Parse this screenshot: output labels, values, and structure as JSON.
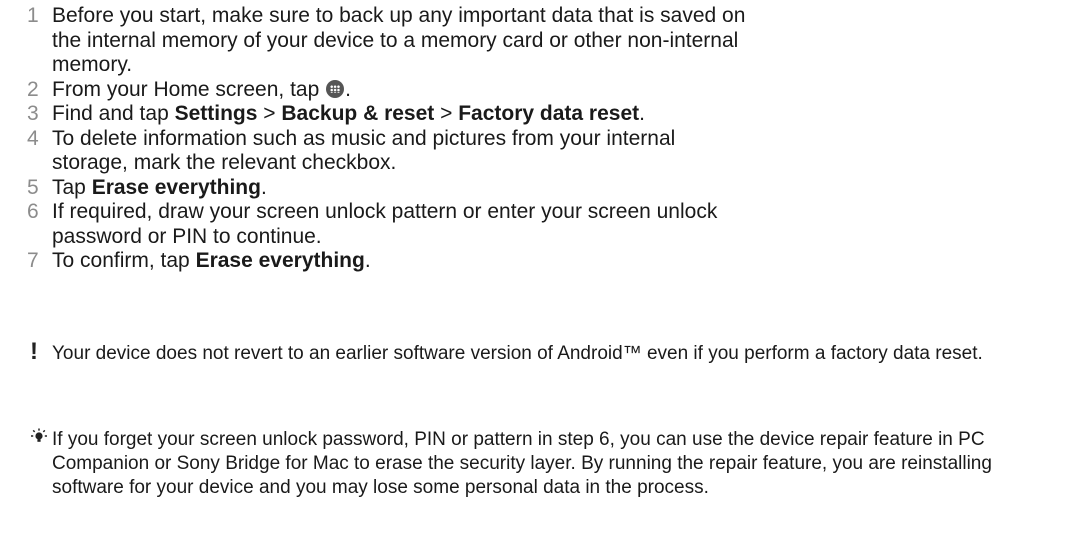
{
  "steps": [
    {
      "num": "1",
      "parts": [
        {
          "text": "Before you start, make sure to back up any important data that is saved on the internal memory of your device to a memory card or other non-internal memory.",
          "bold": false
        }
      ]
    },
    {
      "num": "2",
      "parts": [
        {
          "text": "From your Home screen, tap ",
          "bold": false
        },
        {
          "icon": "apps-icon"
        },
        {
          "text": ".",
          "bold": false
        }
      ]
    },
    {
      "num": "3",
      "parts": [
        {
          "text": "Find and tap ",
          "bold": false
        },
        {
          "text": "Settings",
          "bold": true
        },
        {
          "text": " > ",
          "bold": false
        },
        {
          "text": "Backup & reset",
          "bold": true
        },
        {
          "text": " > ",
          "bold": false
        },
        {
          "text": "Factory data reset",
          "bold": true
        },
        {
          "text": ".",
          "bold": false
        }
      ]
    },
    {
      "num": "4",
      "parts": [
        {
          "text": "To delete information such as music and pictures from your internal storage, mark the relevant checkbox.",
          "bold": false
        }
      ]
    },
    {
      "num": "5",
      "parts": [
        {
          "text": "Tap ",
          "bold": false
        },
        {
          "text": "Erase everything",
          "bold": true
        },
        {
          "text": ".",
          "bold": false
        }
      ]
    },
    {
      "num": "6",
      "parts": [
        {
          "text": "If required, draw your screen unlock pattern or enter your screen unlock password or PIN to continue.",
          "bold": false
        }
      ]
    },
    {
      "num": "7",
      "parts": [
        {
          "text": "To confirm, tap ",
          "bold": false
        },
        {
          "text": "Erase everything",
          "bold": true
        },
        {
          "text": ".",
          "bold": false
        }
      ]
    }
  ],
  "warning": {
    "icon": "exclamation-icon",
    "symbol": "!",
    "text": "Your device does not revert to an earlier software version of Android™ even if you perform a factory data reset."
  },
  "tip": {
    "icon": "lightbulb-icon",
    "text": "If you forget your screen unlock password, PIN or pattern in step 6, you can use the device repair feature in PC Companion or Sony Bridge for Mac to erase the security layer. By running the repair feature, you are reinstalling software for your device and you may lose some personal data in the process."
  }
}
